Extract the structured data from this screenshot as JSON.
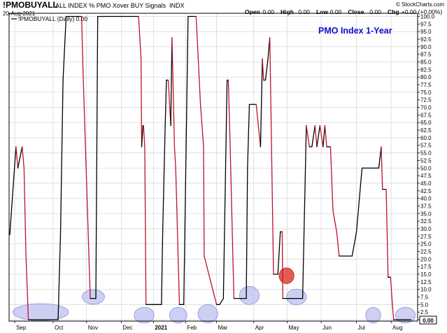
{
  "header": {
    "symbol": "!PMOBUYALL",
    "description": "ALL INDEX % PMO Xover BUY Signals",
    "exchange": "INDX",
    "date": "20-Aug-2021",
    "watermark": "© StockCharts.com",
    "ohlc": [
      {
        "key": "Open",
        "value": "0.00"
      },
      {
        "key": "High",
        "value": "0.00"
      },
      {
        "key": "Low",
        "value": "0.00"
      },
      {
        "key": "Close",
        "value": "0.00"
      },
      {
        "key": "Chg",
        "value": "+0.00 (+0.00%)"
      }
    ]
  },
  "legend": {
    "label": "!PMOBUYALL (Daily) 0.00"
  },
  "annotation": {
    "text": "PMO Index 1-Year"
  },
  "last_value_label": "0.00",
  "colors": {
    "rising": "#000000",
    "falling": "#c0102a",
    "frame": "#000000",
    "grid": "#d9d9d9",
    "highlight_ellipse": "#b8bcee",
    "highlight_red": "#e0403a",
    "annotation": "#1010d0"
  },
  "chart_data": {
    "type": "line",
    "title": "",
    "xlabel": "",
    "ylabel": "",
    "ylim": [
      0,
      100
    ],
    "grid": true,
    "y_ticks": [
      "0.0",
      "2.5",
      "5.0",
      "7.5",
      "10.0",
      "12.5",
      "15.0",
      "17.5",
      "20.0",
      "22.5",
      "25.0",
      "27.5",
      "30.0",
      "32.5",
      "35.0",
      "37.5",
      "40.0",
      "42.5",
      "45.0",
      "47.5",
      "50.0",
      "52.5",
      "55.0",
      "57.5",
      "60.0",
      "62.5",
      "65.0",
      "67.5",
      "70.0",
      "72.5",
      "75.0",
      "77.5",
      "80.0",
      "82.5",
      "85.0",
      "87.5",
      "90.0",
      "92.5",
      "95.0",
      "97.5",
      "100.0"
    ],
    "x_ticks": [
      {
        "label": "Sep",
        "x": 0.08,
        "bold": false
      },
      {
        "label": "Oct",
        "x": 0.7,
        "bold": false
      },
      {
        "label": "Nov",
        "x": 1.24,
        "bold": false
      },
      {
        "label": "Dec",
        "x": 1.8,
        "bold": false
      },
      {
        "label": "2021",
        "x": 2.32,
        "bold": true
      },
      {
        "label": "Feb",
        "x": 2.84,
        "bold": false
      },
      {
        "label": "Mar",
        "x": 3.34,
        "bold": false
      },
      {
        "label": "Apr",
        "x": 3.94,
        "bold": false
      },
      {
        "label": "May",
        "x": 4.48,
        "bold": false
      },
      {
        "label": "Jun",
        "x": 5.03,
        "bold": false
      },
      {
        "label": "Jul",
        "x": 5.6,
        "bold": false
      },
      {
        "label": "Aug",
        "x": 6.16,
        "bold": false
      }
    ],
    "series": [
      {
        "x": [
          0.0,
          0.1,
          0.13,
          0.2,
          0.23,
          0.26,
          0.3,
          0.34,
          0.78,
          0.82,
          0.86,
          0.91,
          0.92,
          1.16,
          1.18,
          1.3,
          1.37,
          1.39,
          1.42,
          2.04,
          2.08,
          2.12,
          2.13,
          2.15,
          2.16,
          2.18,
          2.2,
          2.45,
          2.47,
          2.51,
          2.53,
          2.56,
          2.6,
          2.62,
          2.66,
          2.68,
          2.74,
          2.81,
          2.88,
          2.92,
          3.01,
          3.08,
          3.13,
          3.14,
          3.34,
          3.39,
          3.45,
          3.51,
          3.53,
          3.56,
          3.62,
          3.82,
          3.84,
          3.87,
          3.94,
          3.98,
          4.05,
          4.08,
          4.1,
          4.13,
          4.17,
          4.2,
          4.26,
          4.33,
          4.37,
          4.4,
          4.41,
          4.48,
          4.5,
          4.52,
          4.54,
          4.56,
          4.58,
          4.6,
          4.73,
          4.79,
          4.84,
          4.88,
          4.93,
          4.96,
          5.01,
          5.06,
          5.09,
          5.12,
          5.15,
          5.16,
          5.18,
          5.22,
          5.28,
          5.32,
          5.39,
          5.42,
          5.5,
          5.53,
          5.6,
          5.69,
          5.94,
          5.96,
          6.0,
          6.02,
          6.08,
          6.11,
          6.15,
          6.18,
          6.2,
          6.22,
          6.24,
          6.26,
          6.29,
          6.31,
          6.33,
          6.36,
          6.38,
          6.41,
          6.43,
          6.46,
          6.48
        ],
        "values": [
          28,
          57,
          50,
          57,
          50,
          22,
          0,
          0,
          0,
          29,
          79,
          100,
          100,
          100,
          84,
          7,
          7,
          7,
          100,
          100,
          100,
          86,
          57,
          64,
          64,
          57,
          5,
          5,
          29,
          64,
          79,
          79,
          64,
          93,
          57,
          50,
          5,
          5,
          100,
          100,
          100,
          71,
          57,
          21,
          5,
          5,
          7,
          79,
          79,
          57,
          7,
          7,
          50,
          71,
          71,
          71,
          57,
          86,
          79,
          79,
          86,
          93,
          15,
          15,
          29,
          29,
          7,
          7,
          7,
          7,
          7,
          7,
          7,
          7,
          7,
          64,
          57,
          57,
          64,
          57,
          64,
          57,
          64,
          57,
          57,
          57,
          57,
          36,
          29,
          21,
          21,
          21,
          21,
          21,
          29,
          50,
          50,
          50,
          57,
          43,
          43,
          14,
          14,
          5,
          0,
          0,
          0,
          0,
          0,
          0,
          0,
          0,
          0,
          0,
          0,
          0,
          0
        ]
      }
    ]
  },
  "highlights": [
    {
      "x": 0.5,
      "y": 2.5,
      "rx_days": 0.45,
      "ry": 2.8,
      "kind": "blue"
    },
    {
      "x": 1.35,
      "y": 7.5,
      "rx_days": 0.18,
      "ry": 2.4,
      "kind": "blue"
    },
    {
      "x": 2.17,
      "y": 1.5,
      "rx_days": 0.16,
      "ry": 2.6,
      "kind": "blue"
    },
    {
      "x": 2.72,
      "y": 1.5,
      "rx_days": 0.14,
      "ry": 2.6,
      "kind": "blue"
    },
    {
      "x": 3.2,
      "y": 2.0,
      "rx_days": 0.16,
      "ry": 3.0,
      "kind": "blue"
    },
    {
      "x": 3.87,
      "y": 8.0,
      "rx_days": 0.16,
      "ry": 3.0,
      "kind": "blue"
    },
    {
      "x": 4.47,
      "y": 14.5,
      "rx_days": 0.12,
      "ry": 2.6,
      "kind": "red"
    },
    {
      "x": 4.63,
      "y": 7.5,
      "rx_days": 0.16,
      "ry": 2.6,
      "kind": "blue"
    },
    {
      "x": 5.87,
      "y": 1.5,
      "rx_days": 0.12,
      "ry": 2.6,
      "kind": "blue"
    },
    {
      "x": 6.39,
      "y": 1.5,
      "rx_days": 0.16,
      "ry": 2.6,
      "kind": "blue"
    }
  ]
}
